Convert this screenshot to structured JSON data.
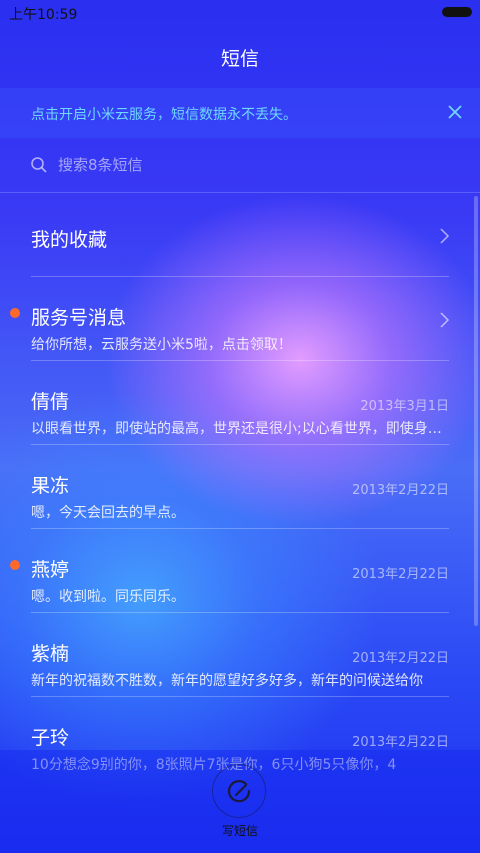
{
  "status_bar": {
    "time": "上午10:59"
  },
  "header": {
    "title": "短信"
  },
  "banner": {
    "text": "点击开启小米云服务，短信数据永不丢失。",
    "close_icon": "close-icon"
  },
  "search": {
    "placeholder": "搜索8条短信",
    "icon": "search-icon"
  },
  "favorites": {
    "label": "我的收藏"
  },
  "conversations": [
    {
      "name": "服务号消息",
      "snippet": "给你所想，云服务送小米5啦，点击领取！",
      "date": "",
      "unread": true
    },
    {
      "name": "倩倩",
      "snippet": "以眼看世界，即使站的最高，世界还是很小;以心看世界，即使身处最低，世界也会很大",
      "date": "2013年3月1日",
      "unread": false
    },
    {
      "name": "果冻",
      "snippet": "嗯，今天会回去的早点。",
      "date": "2013年2月22日",
      "unread": false
    },
    {
      "name": "燕婷",
      "snippet": "嗯。收到啦。同乐同乐。",
      "date": "2013年2月22日",
      "unread": true
    },
    {
      "name": "紫楠",
      "snippet": "新年的祝福数不胜数，新年的愿望好多好多，新年的问候送给你",
      "date": "2013年2月22日",
      "unread": false
    },
    {
      "name": "子玲",
      "snippet": "10分想念9别的你，8张照片7张是你，6只小狗5只像你，4",
      "date": "2013年2月22日",
      "unread": false
    }
  ],
  "compose": {
    "label": "写短信",
    "icon": "compose-icon"
  },
  "colors": {
    "accent": "#6ed8ff",
    "unread_dot": "#ff6a2a"
  }
}
